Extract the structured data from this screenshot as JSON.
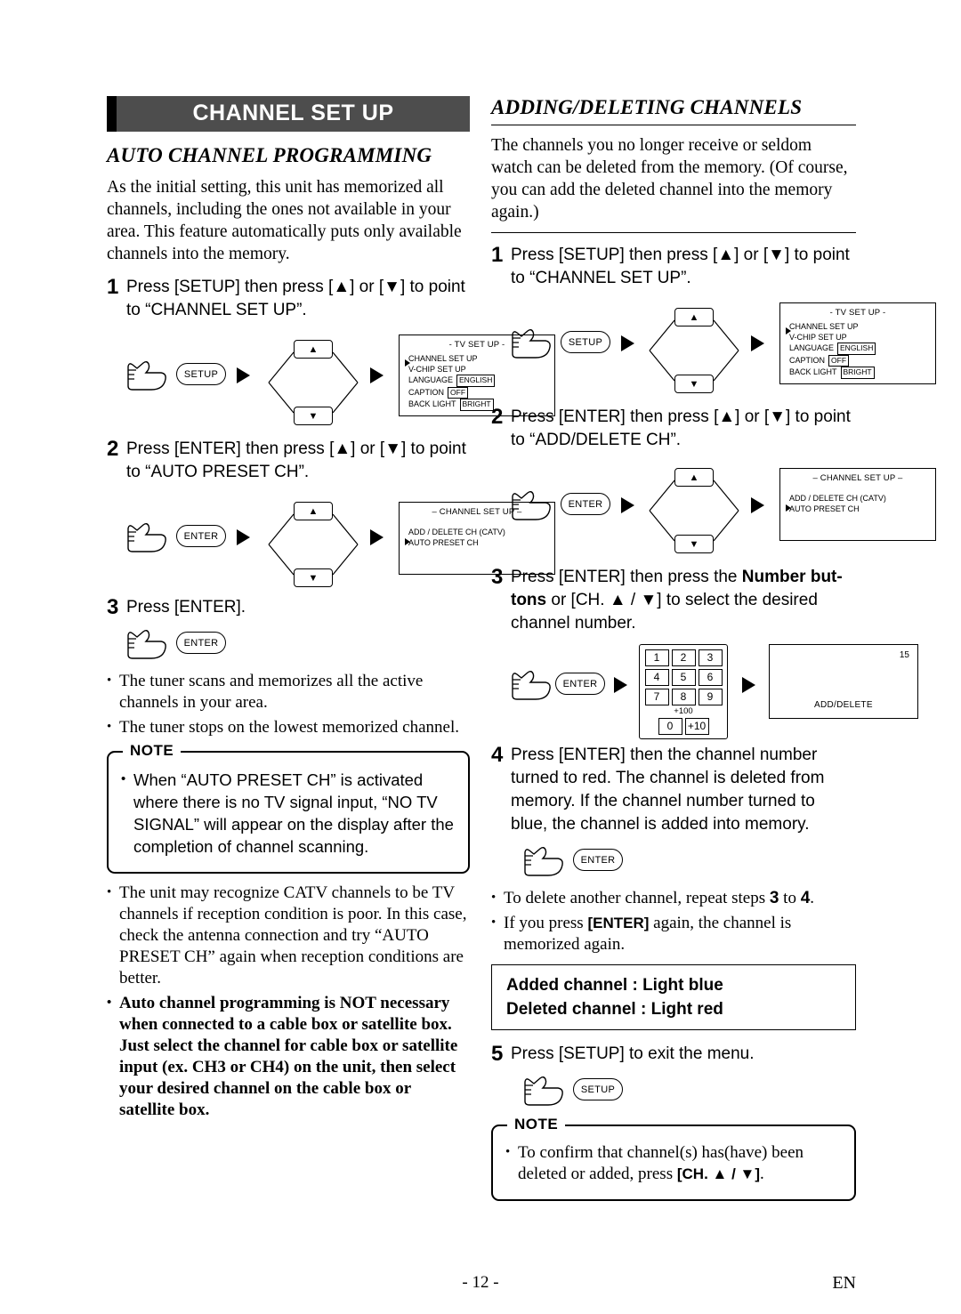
{
  "page": {
    "number": "- 12 -",
    "lang_code": "EN"
  },
  "left": {
    "banner_title": "CHANNEL SET UP",
    "section_title": "AUTO CHANNEL PROGRAMMING",
    "intro": "As the initial setting, this unit has memorized all channels, including the ones not available in your area. This feature automatically puts only available channels into the memory.",
    "step1": {
      "num": "1",
      "text_a": "Press [SETUP] then press [",
      "text_b": "] or [",
      "text_c": "] to point to “CHANNEL SET UP”."
    },
    "step1_diagram": {
      "key": "SETUP",
      "up": "▲",
      "down": "▼",
      "osd_title": "- TV SET UP -",
      "rows": [
        {
          "label": "CHANNEL SET UP",
          "value": ""
        },
        {
          "label": "V-CHIP SET UP",
          "value": ""
        },
        {
          "label": "LANGUAGE",
          "value": "ENGLISH"
        },
        {
          "label": "CAPTION",
          "value": "OFF"
        },
        {
          "label": "BACK LIGHT",
          "value": "BRIGHT"
        }
      ]
    },
    "step2": {
      "num": "2",
      "text_a": "Press [ENTER] then press [",
      "text_b": "] or [",
      "text_c": "] to point to “AUTO PRESET CH”."
    },
    "step2_diagram": {
      "key": "ENTER",
      "up": "▲",
      "down": "▼",
      "osd_title": "– CHANNEL SET UP –",
      "rows": [
        {
          "label": "ADD / DELETE CH (CATV)",
          "value": ""
        },
        {
          "label": "AUTO PRESET CH",
          "value": ""
        }
      ]
    },
    "step3": {
      "num": "3",
      "text": "Press [ENTER].",
      "key": "ENTER"
    },
    "bullets_after": [
      "The tuner scans and memorizes all the active channels in your area.",
      "The tuner stops on the lowest memorized channel."
    ],
    "note": {
      "label": "NOTE",
      "text": "When “AUTO PRESET CH” is activated where there is no TV signal input, “NO TV SIGNAL” will appear on the display after the completion of channel scanning."
    },
    "bullets_tail": [
      "The unit may recognize CATV channels to be TV channels if reception condition is poor. In this case, check the antenna connection and try “AUTO PRESET CH” again when reception conditions are better.",
      "Auto channel programming is NOT necessary when connected to a cable box or satellite box. Just select the channel for cable box or satellite input (ex. CH3 or CH4) on the unit, then select your desired channel on the cable box or satellite box."
    ]
  },
  "right": {
    "section_title": "ADDING/DELETING CHANNELS",
    "intro": "The channels you no longer receive or seldom watch can be deleted from the memory. (Of course, you can add the deleted channel into the memory again.)",
    "step1": {
      "num": "1",
      "text_a": "Press [SETUP] then press [",
      "text_b": "] or [",
      "text_c": "] to point to “CHANNEL SET UP”."
    },
    "step1_diagram": {
      "key": "SETUP",
      "up": "▲",
      "down": "▼",
      "osd_title": "- TV SET UP -",
      "rows": [
        {
          "label": "CHANNEL SET UP",
          "value": ""
        },
        {
          "label": "V-CHIP SET UP",
          "value": ""
        },
        {
          "label": "LANGUAGE",
          "value": "ENGLISH"
        },
        {
          "label": "CAPTION",
          "value": "OFF"
        },
        {
          "label": "BACK LIGHT",
          "value": "BRIGHT"
        }
      ]
    },
    "step2": {
      "num": "2",
      "text_a": "Press [ENTER] then press [",
      "text_b": "] or [",
      "text_c": "] to point to “ADD/DELETE CH”."
    },
    "step2_diagram": {
      "key": "ENTER",
      "up": "▲",
      "down": "▼",
      "osd_title": "– CHANNEL SET UP –",
      "rows": [
        {
          "label": "ADD / DELETE CH (CATV)",
          "value": ""
        },
        {
          "label": "AUTO PRESET CH",
          "value": ""
        }
      ]
    },
    "step3": {
      "num": "3",
      "text_a": "Press [ENTER] then press the ",
      "text_b": "Number but-",
      "text_c": "tons",
      "text_d": " or [CH. ▲ / ▼] to select the desired channel number."
    },
    "step3_diagram": {
      "key": "ENTER",
      "keys": [
        "1",
        "2",
        "3",
        "4",
        "5",
        "6",
        "7",
        "8",
        "9",
        "0",
        "+10"
      ],
      "plus100": "+100",
      "osd_channel": "15",
      "osd_label": "ADD/DELETE"
    },
    "step4": {
      "num": "4",
      "text": "Press [ENTER] then the channel number turned to red. The channel is deleted from memory. If the channel number turned to blue, the channel is added into memory.",
      "key": "ENTER"
    },
    "bullets": [
      "To delete another channel, repeat steps 3 to 4.",
      "If you press [ENTER] again, the channel is memorized again."
    ],
    "bullet1_parts": {
      "a": "To delete another channel, repeat steps ",
      "num1": "3",
      "b": " to ",
      "num2": "4",
      "c": "."
    },
    "bullet2_parts": {
      "a": "If you press ",
      "b": "[ENTER]",
      "c": " again, the channel is memorized again."
    },
    "color_box": {
      "added": "Added channel   : Light blue",
      "deleted": "Deleted channel : Light red"
    },
    "step5": {
      "num": "5",
      "text": "Press [SETUP] to exit the menu.",
      "key": "SETUP"
    },
    "note": {
      "label": "NOTE",
      "text_a": "To confirm that channel(s) has(have) been deleted or added, press ",
      "text_b": "[CH. ▲ / ▼]",
      "text_c": "."
    }
  }
}
